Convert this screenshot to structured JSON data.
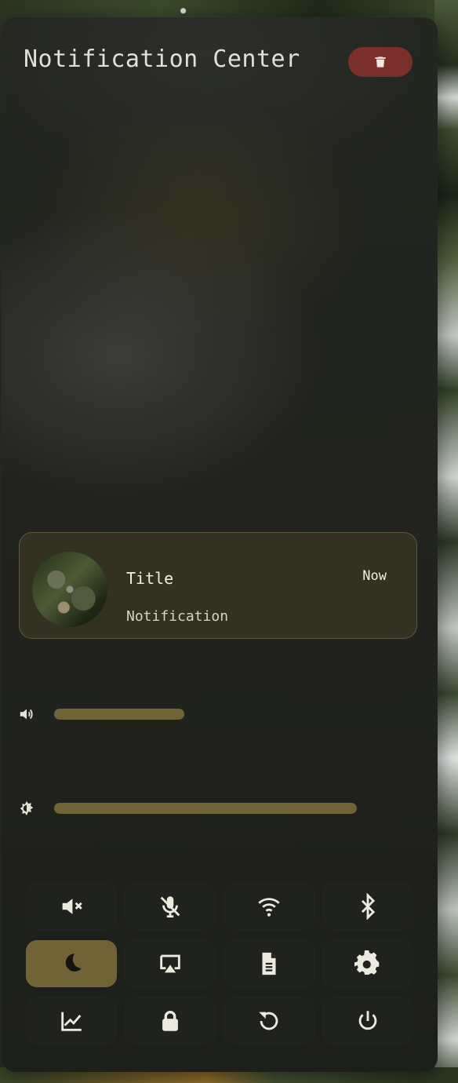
{
  "window": {
    "title": "Notification Center",
    "clear_icon": "trash-icon",
    "accent_color": "#706436",
    "danger_color": "#7b2f2c"
  },
  "notification": {
    "title": "Title",
    "time": "Now",
    "body": "Notification",
    "image": "circular nature photo thumbnail"
  },
  "sliders": [
    {
      "name": "volume",
      "icon": "volume-icon",
      "value": 0.43
    },
    {
      "name": "brightness",
      "icon": "brightness-icon",
      "value": 1.0
    }
  ],
  "toggles": [
    {
      "name": "mute-audio",
      "icon": "volume-mute-icon",
      "active": false
    },
    {
      "name": "mute-microphone",
      "icon": "microphone-off-icon",
      "active": false
    },
    {
      "name": "wifi",
      "icon": "wifi-icon",
      "active": false
    },
    {
      "name": "bluetooth",
      "icon": "bluetooth-icon",
      "active": false
    },
    {
      "name": "do-not-disturb",
      "icon": "moon-icon",
      "active": true
    },
    {
      "name": "screen-cast",
      "icon": "cast-screen-icon",
      "active": false
    },
    {
      "name": "document",
      "icon": "document-icon",
      "active": false
    },
    {
      "name": "settings",
      "icon": "gear-icon",
      "active": false
    },
    {
      "name": "system-monitor",
      "icon": "chart-icon",
      "active": false
    },
    {
      "name": "lock-screen",
      "icon": "lock-icon",
      "active": false
    },
    {
      "name": "restart",
      "icon": "restart-icon",
      "active": false
    },
    {
      "name": "power",
      "icon": "power-icon",
      "active": false
    }
  ]
}
